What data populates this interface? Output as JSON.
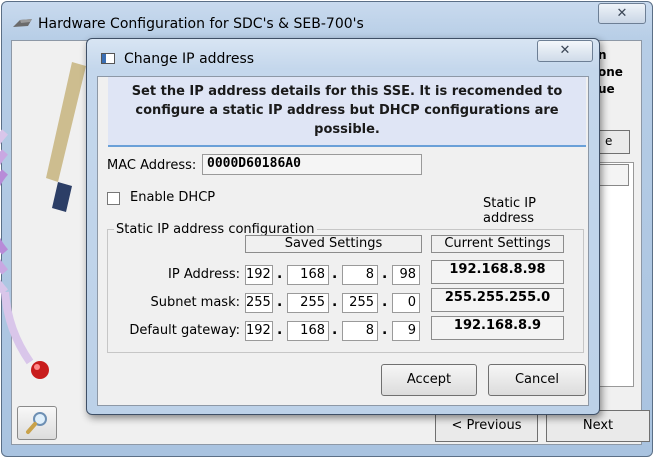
{
  "outer_window": {
    "title": "Hardware Configuration for SDC's & SEB-700's",
    "close_glyph": "✕",
    "side_text": [
      "n",
      "one",
      "ue"
    ],
    "side_button_label": "e",
    "previous_label": "< Previous",
    "next_label": "Next"
  },
  "dialog": {
    "title": "Change IP address",
    "close_glyph": "✕",
    "info_text": "Set the IP address details for this SSE. It is recomended to configure a static IP address but DHCP configurations are possible.",
    "mac_label": "MAC Address:",
    "mac_value": "0000D60186A0",
    "dhcp_label": "Enable DHCP",
    "dhcp_checked": false,
    "mode_text": "Static IP address",
    "group_label": "Static IP address configuration",
    "saved_header": "Saved Settings",
    "current_header": "Current Settings",
    "rows": [
      {
        "label": "IP Address:",
        "octets": [
          "192",
          "168",
          "8",
          "98"
        ],
        "current": "192.168.8.98"
      },
      {
        "label": "Subnet mask:",
        "octets": [
          "255",
          "255",
          "255",
          "0"
        ],
        "current": "255.255.255.0"
      },
      {
        "label": "Default gateway:",
        "octets": [
          "192",
          "168",
          "8",
          "9"
        ],
        "current": "192.168.8.9"
      }
    ],
    "dot": ".",
    "accept_label": "Accept",
    "cancel_label": "Cancel"
  },
  "colors": {
    "title_gradient": "#c4d7ec",
    "info_background": "#dfe5f5",
    "info_border": "#6aa0d8"
  },
  "icons": [
    "window-app-icon",
    "close-icon",
    "magnifier-icon",
    "wireless-device-icon"
  ]
}
